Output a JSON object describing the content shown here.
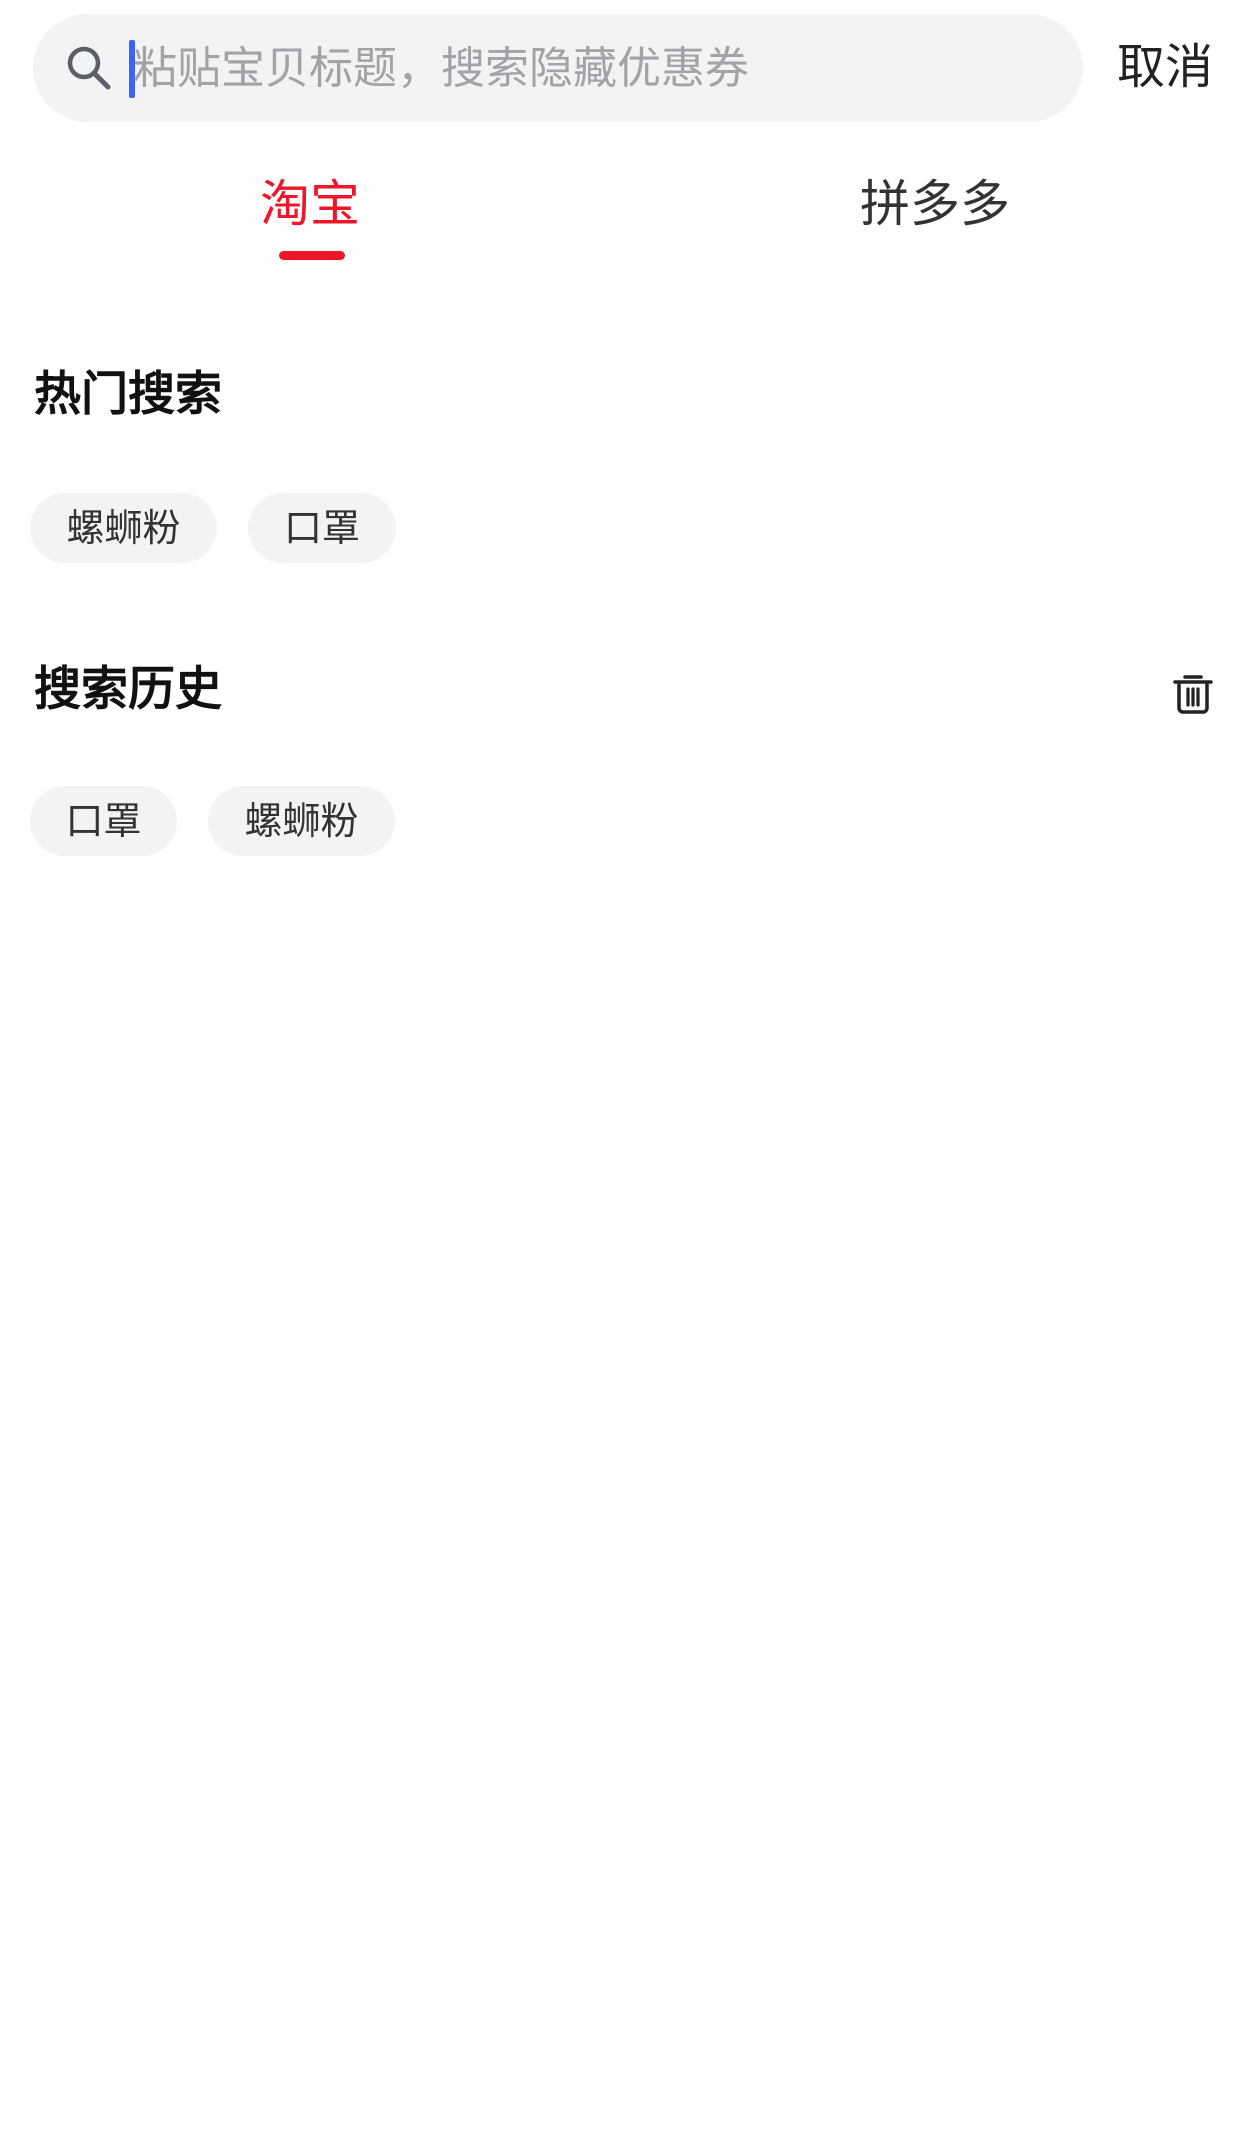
{
  "search": {
    "placeholder": "粘贴宝贝标题，搜索隐藏优惠券",
    "value": "",
    "cancel_label": "取消"
  },
  "tabs": [
    {
      "label": "淘宝",
      "active": true
    },
    {
      "label": "拼多多",
      "active": false
    }
  ],
  "hot_search": {
    "title": "热门搜索",
    "items": [
      "螺蛳粉",
      "口罩"
    ]
  },
  "search_history": {
    "title": "搜索历史",
    "items": [
      "口罩",
      "螺蛳粉"
    ]
  },
  "colors": {
    "accent": "#f0162a",
    "caret": "#3d63f0",
    "chip_bg": "#f2f3f5",
    "search_bg": "#f2f3f5",
    "placeholder": "#a1a3a6"
  },
  "icons": {
    "search": "search-icon",
    "trash": "trash-icon"
  }
}
